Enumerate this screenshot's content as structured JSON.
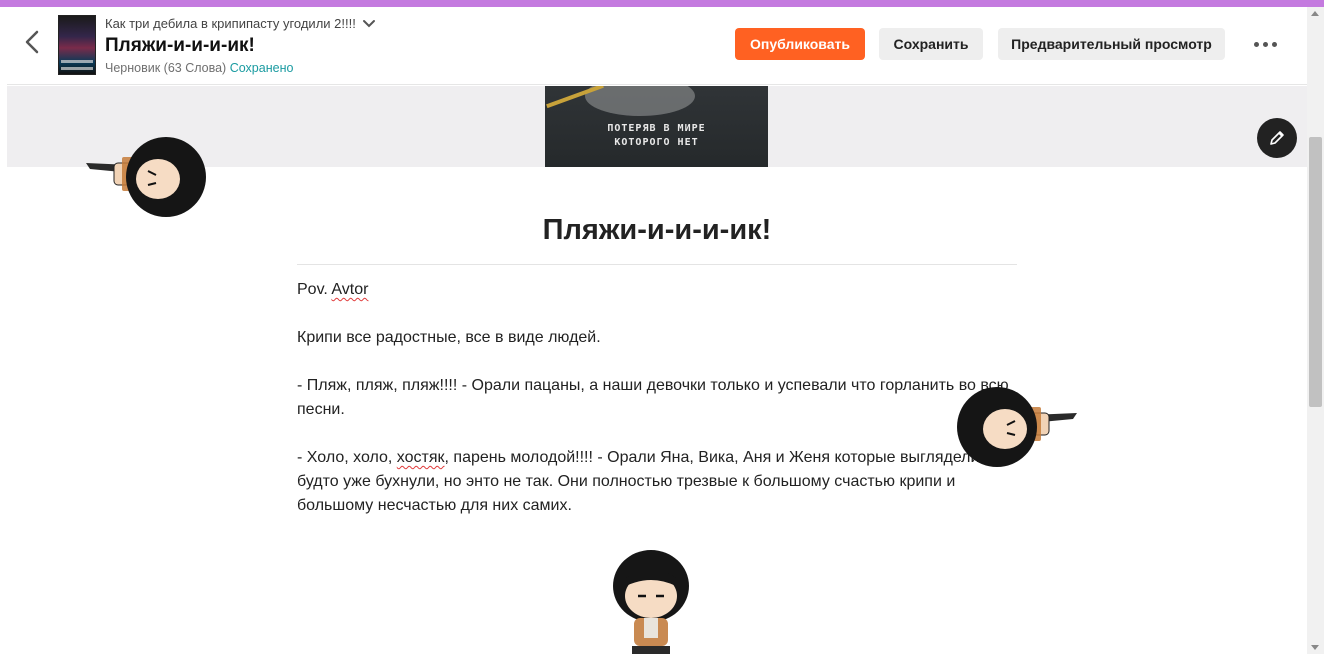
{
  "header": {
    "story_title": "Как три дебила в крипипасту угодили 2!!!!",
    "part_title": "Пляжи-и-и-и-ик!",
    "meta_status": "Черновик (63 Слова)",
    "meta_saved": "Сохранено",
    "publish_label": "Опубликовать",
    "save_label": "Сохранить",
    "preview_label": "Предварительный просмотр"
  },
  "banner": {
    "caption_line1": "ПОТЕРЯВ В МИРЕ",
    "caption_line2": "КОТОРОГО НЕТ"
  },
  "document": {
    "title": "Пляжи-и-и-и-ик!",
    "pov_prefix": "Pov. ",
    "pov_name": "Avtor",
    "paragraph_2": "Крипи все радостные, все в виде людей.",
    "paragraph_3": "- Пляж, пляж, пляж!!!! - Орали пацаны, а наши девочки только и успевали что горланить во всю песни.",
    "paragraph_4_before": "- Холо, холо, ",
    "paragraph_4_flagged": "хостяк",
    "paragraph_4_after": ", парень молодой!!!! - Орали Яна, Вика, Аня и Женя которые выглядели так будто уже бухнули, но энто не так. Они полностью трезвые к большому счастью крипи и большому несчастью для них самих."
  },
  "colors": {
    "accent_bar": "#c47adf",
    "publish_button": "#ff6122",
    "saved_text": "#1a9ba1",
    "spellcheck_underline": "#e03a3a"
  },
  "icons": {
    "back": "chevron-left-icon",
    "dropdown": "chevron-down-icon",
    "more": "more-horizontal-icon",
    "edit": "pencil-icon"
  }
}
